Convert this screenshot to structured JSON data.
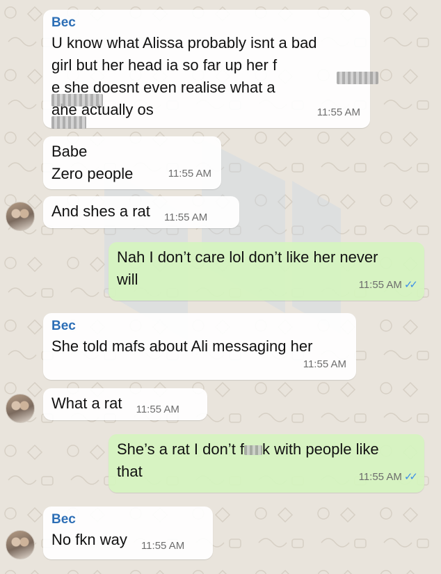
{
  "colors": {
    "incoming_bubble": "#ffffff",
    "outgoing_bubble": "#d5f4bf",
    "sender_name": "#2d6fb6",
    "read_ticks": "#3b8ee8"
  },
  "messages": [
    {
      "sender": "Bec",
      "text": "U know what Alissa probably isnt a bad\ngirl but her head ia so far up her f\n e she doesnt even realise what a\n ahe actually os",
      "time": "11:55 AM"
    },
    {
      "text": "Babe\nZero people",
      "time": "11:55 AM"
    },
    {
      "text": "And shes a rat",
      "time": "11:55 AM"
    },
    {
      "text": "Nah I don’t care lol don’t like her never\nwill",
      "time": "11:55 AM",
      "read_icon": "double-check-icon"
    },
    {
      "sender": "Bec",
      "text": "She told mafs about Ali messaging her",
      "time": "11:55 AM"
    },
    {
      "text": "What a rat",
      "time": "11:55 AM"
    },
    {
      "text_before": "She’s a rat I don’t f",
      "text_after": "k with people like\nthat",
      "time": "11:55 AM",
      "read_icon": "double-check-icon"
    },
    {
      "sender": "Bec",
      "text": "No fkn way",
      "time": "11:55 AM"
    }
  ]
}
